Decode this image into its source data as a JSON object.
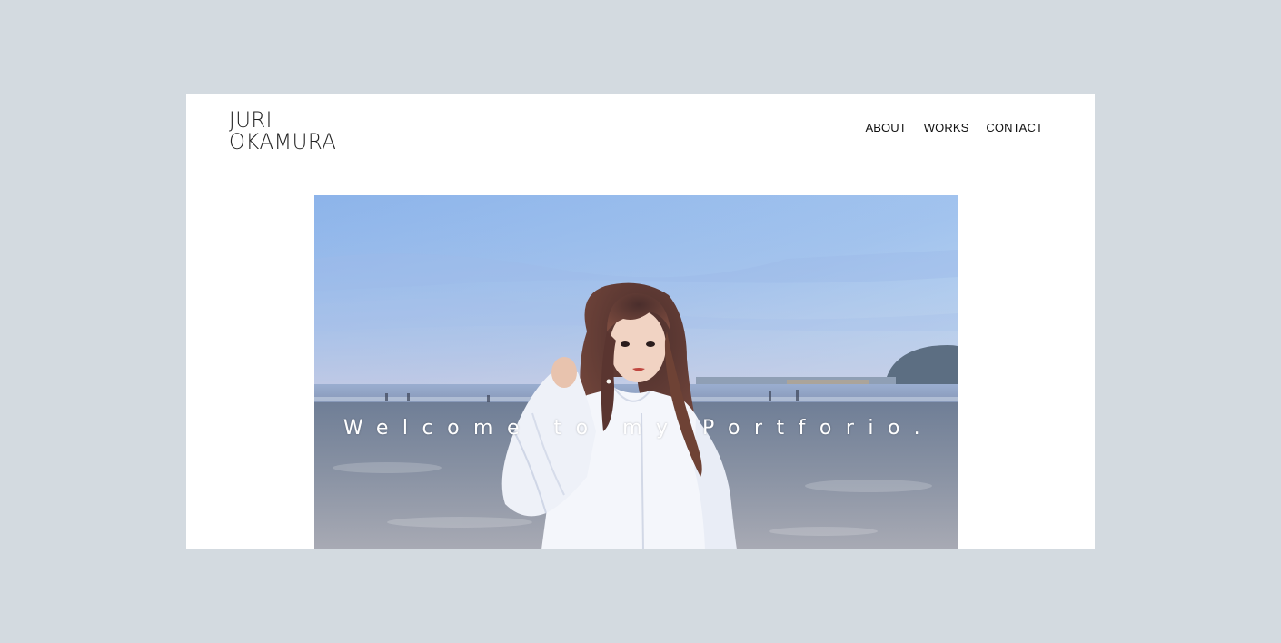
{
  "logo": {
    "line1": "JURI",
    "line2": "OKAMURA"
  },
  "nav": {
    "items": [
      {
        "label": "ABOUT"
      },
      {
        "label": "WORKS"
      },
      {
        "label": "CONTACT"
      }
    ]
  },
  "hero": {
    "tagline": "Welcome to my Portforio."
  },
  "colors": {
    "background": "#d3dae0",
    "page": "#ffffff",
    "text": "#111111"
  }
}
